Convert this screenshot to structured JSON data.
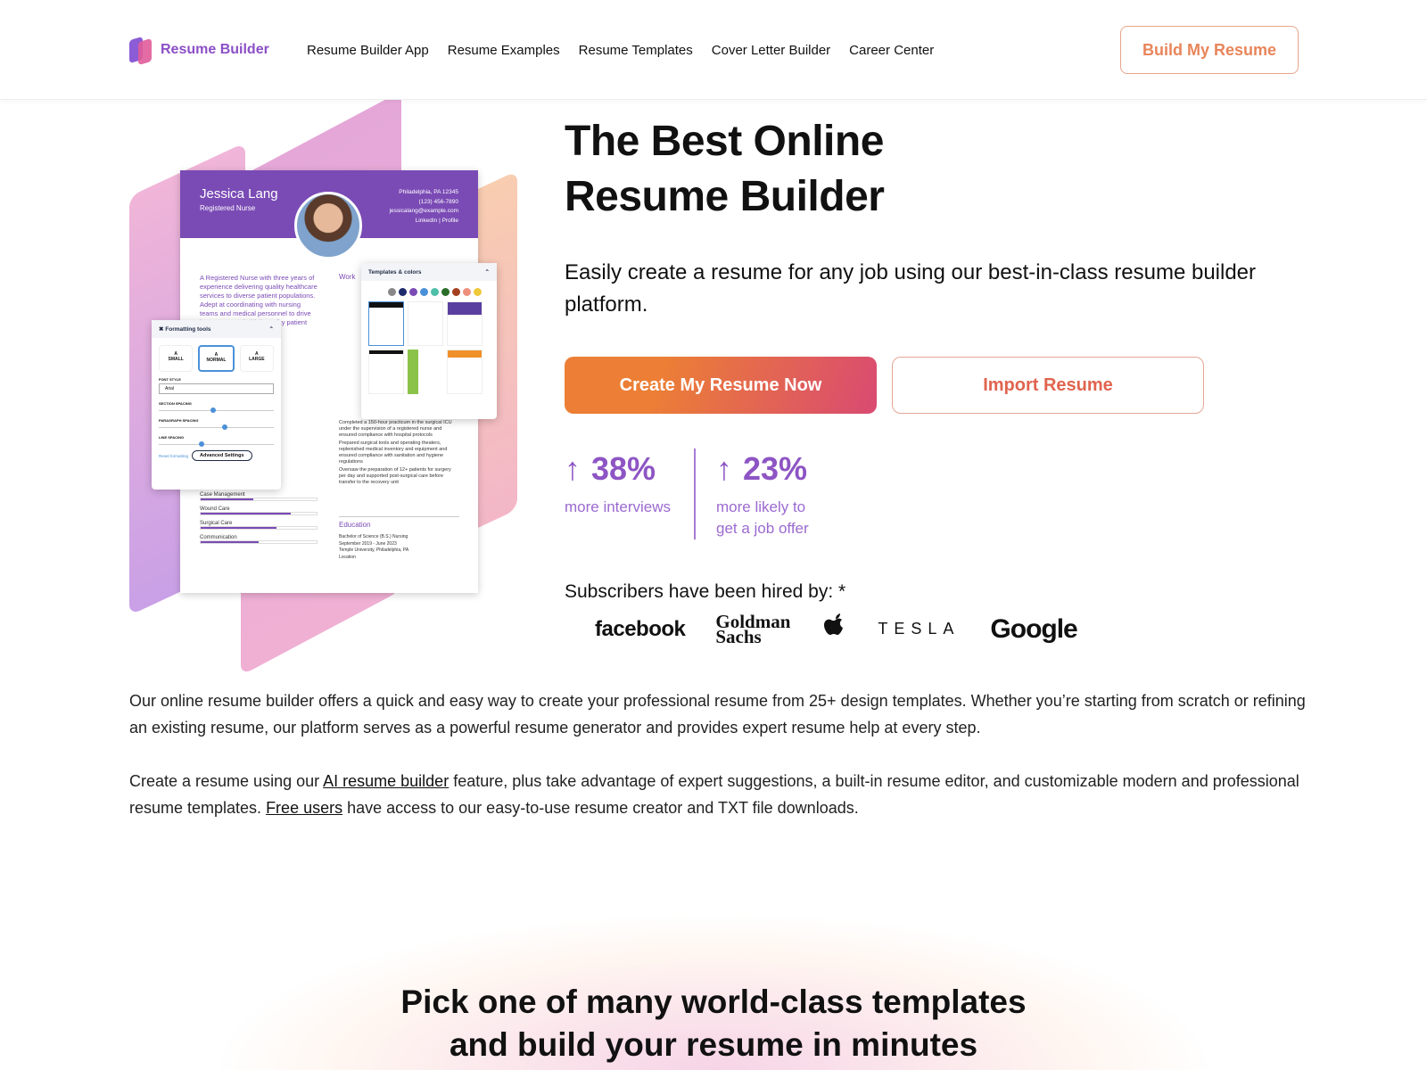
{
  "nav": {
    "brand": "Resume Builder",
    "links": [
      "Resume Builder App",
      "Resume Examples",
      "Resume Templates",
      "Cover Letter Builder",
      "Career Center"
    ],
    "cta": "Build My Resume"
  },
  "illustration": {
    "name": "Jessica Lang",
    "role": "Registered Nurse",
    "contact": [
      "Philadelphia, PA 12345",
      "(123) 456-7890",
      "jessicalang@example.com",
      "LinkedIn | Profile"
    ],
    "summary": "A Registered Nurse with three years of experience delivering quality healthcare services to diverse patient populations. Adept at coordinating with nursing teams and medical personnel to drive improvements in high-quality patient care.",
    "work": "Work",
    "education": "Education",
    "education_lines": [
      "Bachelor of Science (B.S.) Nursing",
      "September 2019 - June 2023",
      "Temple University, Philadelphia, PA",
      "Location"
    ],
    "bullets": [
      "Completed a 150-hour practicum in the surgical ICU under the supervision of a registered nurse and ensured compliance with hospital protocols",
      "Prepared surgical tools and operating theaters, replenished medical inventory and equipment and ensured compliance with sanitation and hygiene regulations",
      "Oversaw the preparation of 12+ patients for surgery per day and supported post-surgical care before transfer to the recovery unit"
    ],
    "skills": [
      {
        "name": "Case Management",
        "level": 0.45
      },
      {
        "name": "Wound Care",
        "level": 0.78
      },
      {
        "name": "Surgical Care",
        "level": 0.65
      },
      {
        "name": "Communication",
        "level": 0.5
      }
    ],
    "templates_panel": "Templates & colors",
    "swatches": [
      "#888888",
      "#1d2a6b",
      "#7a4bb5",
      "#4a90d9",
      "#4dbfa8",
      "#2b6e2b",
      "#a4401f",
      "#ee8f7c",
      "#f0c93a"
    ],
    "formatting": {
      "title": "Formatting tools",
      "sizes": [
        "SMALL",
        "NORMAL",
        "LARGE"
      ],
      "font_style_label": "FONT STYLE",
      "font": "Arial",
      "section": "SECTION SPACING",
      "paragraph": "PARAGRAPH SPACING",
      "line": "LINE SPACING",
      "section_val": 0.45,
      "paragraph_val": 0.55,
      "line_val": 0.35,
      "reset": "Reset formatting",
      "advanced": "Advanced Settings"
    }
  },
  "hero": {
    "title_line1": "The Best Online",
    "title_line2": "Resume Builder",
    "subtitle": "Easily create a resume for any job using our best-in-class resume builder platform.",
    "primary": "Create My Resume Now",
    "secondary": "Import Resume"
  },
  "stats": [
    {
      "value": "38%",
      "label1": "more interviews",
      "label2": ""
    },
    {
      "value": "23%",
      "label1": "more likely to",
      "label2": "get a job offer"
    }
  ],
  "hired": {
    "label": "Subscribers have been hired by: *",
    "companies": [
      "facebook",
      "Goldman Sachs",
      "Apple",
      "TESLA",
      "Google"
    ]
  },
  "body": {
    "p1": "Our online resume builder offers a quick and easy way to create your professional resume from 25+ design templates. Whether you’re starting from scratch or refining an existing resume, our platform serves as a powerful resume generator and provides expert resume help at every step.",
    "p2_a": "Create a resume using our ",
    "p2_link1": "AI resume builder",
    "p2_b": " feature, plus take advantage of expert suggestions, a built-in resume editor, and customizable modern and professional resume templates. ",
    "p2_link2": "Free users",
    "p2_c": " have access to our easy-to-use resume creator and TXT file downloads."
  },
  "section2": {
    "line1": "Pick one of many world-class templates",
    "line2": "and build your resume in minutes"
  },
  "colors": {
    "brand": "#8b4fc6",
    "accent_orange": "#ec7f35",
    "accent_pink": "#d94a72"
  }
}
